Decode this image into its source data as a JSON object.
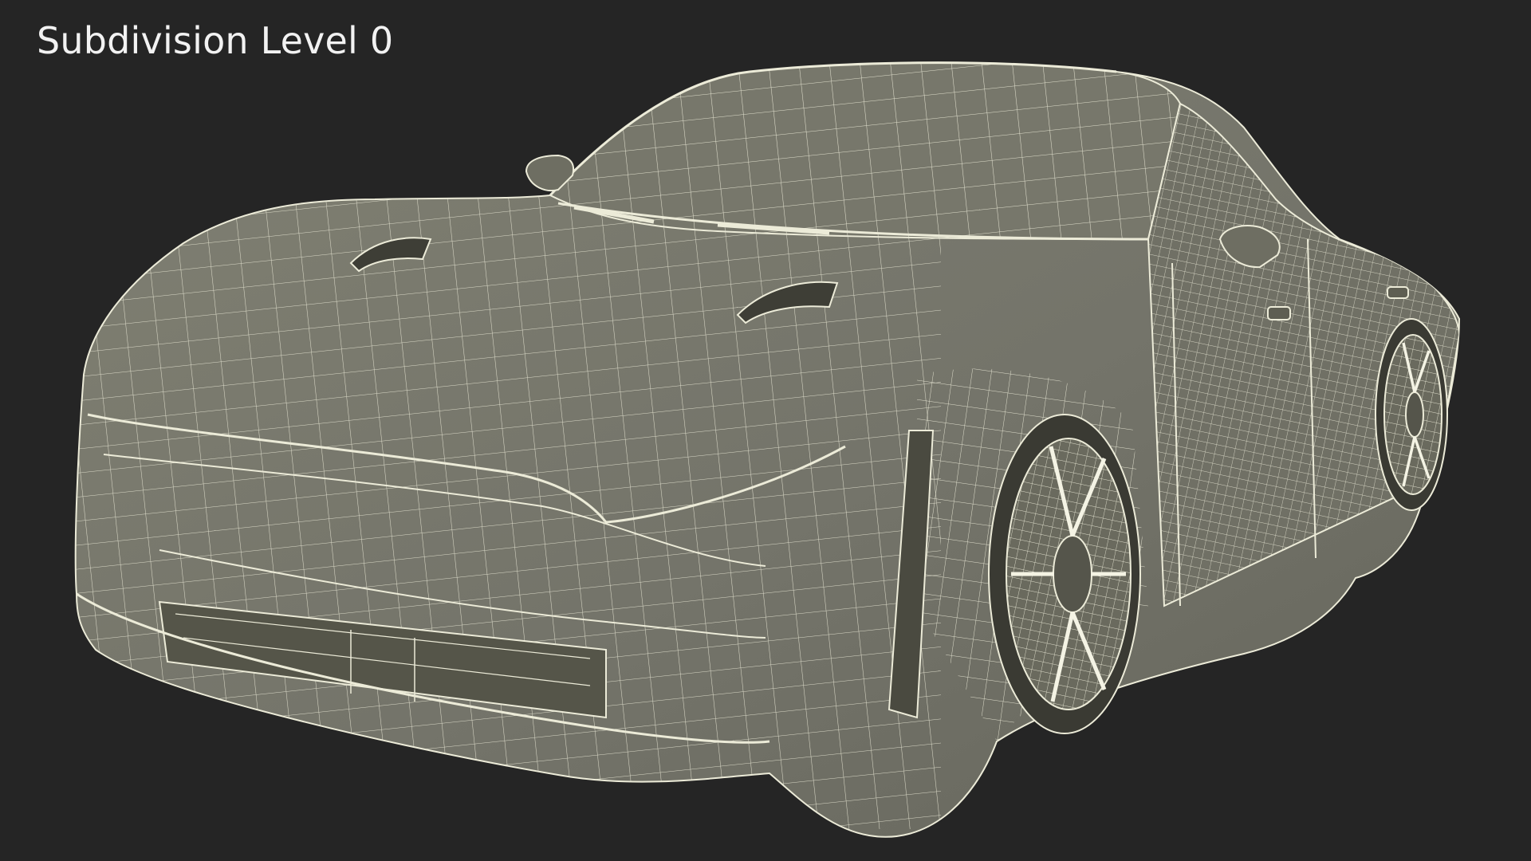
{
  "caption": "Subdivision Level 0",
  "colors": {
    "background": "#252525",
    "body_surface": "#7a7a6c",
    "body_shadow": "#5e5e52",
    "body_dark": "#4a4a40",
    "wire": "#ecebd8",
    "caption_text": "#f2f2f2"
  },
  "subject": {
    "icon": "sports-car-wireframe-icon"
  }
}
